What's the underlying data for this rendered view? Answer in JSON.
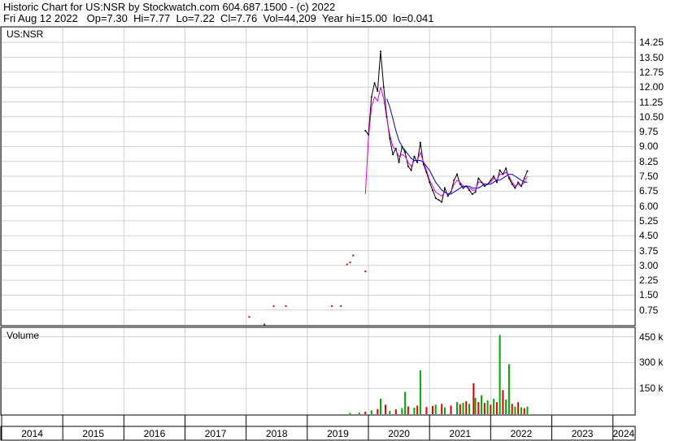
{
  "header": {
    "line1": "Historic Chart for US:NSR by Stockwatch.com 604.687.1500 - (c) 2022",
    "line2": "Fri Aug 12 2022   Op=7.30  Hi=7.77  Lo=7.22  Cl=7.76  Vol=44,209  Year hi=15.00  lo=0.041"
  },
  "price_panel": {
    "label": "US:NSR"
  },
  "volume_panel": {
    "label": "Volume"
  },
  "colors": {
    "price": "#000000",
    "ma_short": "#e000e0",
    "ma_long": "#0000e0",
    "up": "#00aa00",
    "down": "#dd0000",
    "grid": "#d0d0d0"
  },
  "chart_data": [
    {
      "type": "line",
      "title": "US:NSR",
      "ylim": [
        0,
        15
      ],
      "yticks": [
        "14.25",
        "13.50",
        "12.75",
        "12.00",
        "11.25",
        "10.50",
        "9.75",
        "9.00",
        "8.25",
        "7.50",
        "6.75",
        "6.00",
        "5.25",
        "4.50",
        "3.75",
        "3.00",
        "2.25",
        "1.50",
        "0.75"
      ],
      "xlabels": [
        "2014",
        "2015",
        "2016",
        "2017",
        "2018",
        "2019",
        "2020",
        "2021",
        "2022",
        "2023",
        "2024"
      ],
      "sparse_trades": [
        {
          "x": 2018.05,
          "y": 0.4
        },
        {
          "x": 2018.3,
          "y": 0.02
        },
        {
          "x": 2018.45,
          "y": 0.95
        },
        {
          "x": 2018.65,
          "y": 0.95
        },
        {
          "x": 2019.4,
          "y": 0.95
        },
        {
          "x": 2019.55,
          "y": 0.95
        },
        {
          "x": 2019.65,
          "y": 3.05
        },
        {
          "x": 2019.7,
          "y": 3.15
        },
        {
          "x": 2019.75,
          "y": 3.5
        },
        {
          "x": 2019.95,
          "y": 2.7
        }
      ],
      "series": [
        {
          "name": "",
          "x": [
            2019.95,
            2020.0,
            2020.05,
            2020.1,
            2020.15,
            2020.2,
            2020.25,
            2020.3,
            2020.35,
            2020.4,
            2020.45,
            2020.5,
            2020.55,
            2020.6,
            2020.65,
            2020.7,
            2020.75,
            2020.8,
            2020.85,
            2020.9,
            2020.95,
            2021.0,
            2021.05,
            2021.1,
            2021.15,
            2021.2,
            2021.25,
            2021.3,
            2021.35,
            2021.4,
            2021.45,
            2021.5,
            2021.55,
            2021.6,
            2021.65,
            2021.7,
            2021.75,
            2021.8,
            2021.85,
            2021.9,
            2021.95,
            2022.0,
            2022.05,
            2022.1,
            2022.15,
            2022.2,
            2022.25,
            2022.3,
            2022.35,
            2022.4,
            2022.45,
            2022.5,
            2022.55,
            2022.6
          ],
          "values": [
            9.8,
            9.6,
            11.5,
            12.2,
            11.8,
            13.8,
            12.0,
            10.5,
            9.4,
            8.6,
            8.9,
            8.2,
            9.0,
            8.7,
            8.0,
            7.8,
            8.5,
            8.2,
            9.2,
            8.1,
            7.7,
            7.2,
            6.8,
            6.4,
            6.3,
            6.2,
            6.9,
            6.5,
            6.7,
            7.3,
            7.6,
            7.1,
            6.9,
            7.0,
            6.8,
            6.6,
            6.7,
            7.4,
            7.2,
            7.0,
            7.1,
            7.3,
            7.5,
            7.2,
            7.8,
            7.6,
            7.9,
            7.4,
            7.1,
            6.9,
            7.2,
            7.0,
            7.4,
            7.76
          ]
        },
        {
          "name": "",
          "x": [
            2019.95,
            2020.0,
            2020.05,
            2020.1,
            2020.15,
            2020.2,
            2020.25,
            2020.3,
            2020.35,
            2020.4,
            2020.45,
            2020.5,
            2020.55,
            2020.6,
            2020.65,
            2020.7,
            2020.75,
            2020.8,
            2020.85,
            2020.9,
            2020.95,
            2021.0,
            2021.05,
            2021.1,
            2021.15,
            2021.2,
            2021.25,
            2021.3,
            2021.35,
            2021.4,
            2021.45,
            2021.5,
            2021.55,
            2021.6,
            2021.65,
            2021.7,
            2021.75,
            2021.8,
            2021.85,
            2021.9,
            2021.95,
            2022.0,
            2022.05,
            2022.1,
            2022.15,
            2022.2,
            2022.25,
            2022.3,
            2022.35,
            2022.4,
            2022.45,
            2022.5,
            2022.55,
            2022.6
          ],
          "values": [
            6.6,
            9.4,
            11.0,
            11.5,
            11.3,
            12.0,
            11.4,
            10.4,
            9.6,
            9.0,
            8.8,
            8.5,
            8.6,
            8.5,
            8.2,
            8.0,
            8.3,
            8.3,
            8.7,
            8.2,
            7.8,
            7.3,
            7.0,
            6.7,
            6.6,
            6.5,
            6.7,
            6.6,
            6.7,
            7.1,
            7.3,
            7.2,
            7.0,
            7.0,
            6.9,
            6.8,
            6.8,
            7.2,
            7.2,
            7.1,
            7.1,
            7.2,
            7.4,
            7.3,
            7.6,
            7.6,
            7.7,
            7.5,
            7.2,
            7.0,
            7.1,
            7.0,
            7.2,
            7.5
          ]
        },
        {
          "name": "",
          "x": [
            2020.3,
            2020.35,
            2020.4,
            2020.45,
            2020.5,
            2020.55,
            2020.6,
            2020.65,
            2020.7,
            2020.75,
            2020.8,
            2020.85,
            2020.9,
            2020.95,
            2021.0,
            2021.05,
            2021.1,
            2021.15,
            2021.2,
            2021.25,
            2021.3,
            2021.35,
            2021.4,
            2021.45,
            2021.5,
            2021.55,
            2021.6,
            2021.65,
            2021.7,
            2021.75,
            2021.8,
            2021.85,
            2021.9,
            2021.95,
            2022.0,
            2022.05,
            2022.1,
            2022.15,
            2022.2,
            2022.25,
            2022.3,
            2022.35,
            2022.4,
            2022.45,
            2022.5,
            2022.55,
            2022.6
          ],
          "values": [
            11.4,
            11.0,
            10.4,
            9.8,
            9.3,
            9.0,
            8.8,
            8.6,
            8.4,
            8.3,
            8.3,
            8.3,
            8.2,
            8.0,
            7.8,
            7.5,
            7.2,
            7.0,
            6.8,
            6.7,
            6.6,
            6.6,
            6.7,
            6.8,
            6.9,
            7.0,
            7.0,
            7.0,
            6.9,
            6.9,
            6.9,
            7.0,
            7.1,
            7.1,
            7.1,
            7.2,
            7.3,
            7.3,
            7.4,
            7.5,
            7.6,
            7.6,
            7.5,
            7.4,
            7.3,
            7.2,
            7.2
          ]
        }
      ]
    },
    {
      "type": "bar",
      "title": "Volume",
      "ylim": [
        0,
        500000
      ],
      "yticks": [
        "450 k",
        "300 k",
        "150 k"
      ],
      "x": [
        2019.7,
        2019.85,
        2019.95,
        2020.05,
        2020.15,
        2020.2,
        2020.28,
        2020.35,
        2020.45,
        2020.55,
        2020.6,
        2020.65,
        2020.75,
        2020.8,
        2020.85,
        2020.95,
        2021.05,
        2021.1,
        2021.2,
        2021.25,
        2021.35,
        2021.45,
        2021.5,
        2021.55,
        2021.6,
        2021.65,
        2021.72,
        2021.75,
        2021.8,
        2021.85,
        2021.9,
        2021.95,
        2022.0,
        2022.05,
        2022.1,
        2022.15,
        2022.2,
        2022.25,
        2022.3,
        2022.35,
        2022.4,
        2022.45,
        2022.5,
        2022.55,
        2022.6
      ],
      "values": [
        8000,
        10000,
        14000,
        22000,
        30000,
        90000,
        55000,
        20000,
        28000,
        35000,
        130000,
        45000,
        38000,
        50000,
        255000,
        42000,
        48000,
        55000,
        60000,
        40000,
        50000,
        70000,
        58000,
        66000,
        75000,
        60000,
        180000,
        95000,
        70000,
        110000,
        65000,
        80000,
        55000,
        90000,
        70000,
        460000,
        140000,
        85000,
        290000,
        60000,
        45000,
        70000,
        40000,
        35000,
        44209
      ],
      "up": [
        true,
        true,
        false,
        true,
        false,
        true,
        false,
        true,
        false,
        true,
        true,
        false,
        true,
        false,
        true,
        false,
        false,
        true,
        false,
        true,
        false,
        true,
        false,
        true,
        false,
        true,
        false,
        true,
        false,
        true,
        false,
        true,
        false,
        true,
        false,
        true,
        false,
        true,
        true,
        false,
        true,
        false,
        true,
        false,
        true
      ]
    }
  ]
}
